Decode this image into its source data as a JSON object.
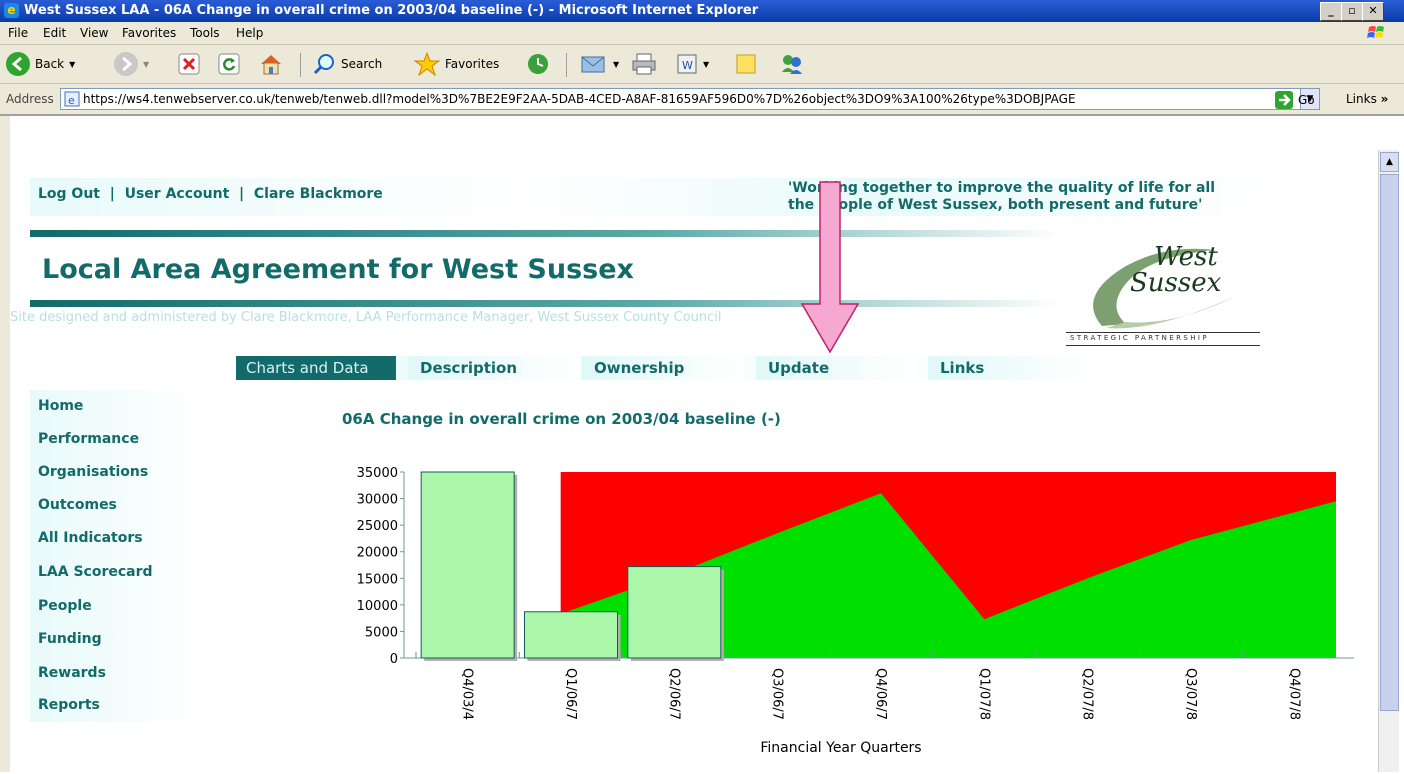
{
  "window": {
    "title": "West Sussex LAA - 06A Change in overall crime on 2003/04 baseline (-) - Microsoft Internet Explorer"
  },
  "menu": [
    "File",
    "Edit",
    "View",
    "Favorites",
    "Tools",
    "Help"
  ],
  "toolbar": {
    "back": "Back",
    "search": "Search",
    "favorites": "Favorites"
  },
  "address": {
    "label": "Address",
    "url": "https://ws4.tenwebserver.co.uk/tenweb/tenweb.dll?model%3D%7BE2E9F2AA-5DAB-4CED-A8AF-81659AF596D0%7D%26object%3DO9%3A100%26type%3DOBJPAGE",
    "go": "Go",
    "links": "Links"
  },
  "site": {
    "user_links": [
      "Log Out",
      "User Account",
      "Clare Blackmore"
    ],
    "slogan_line1": "'Working together to improve the quality of life for all",
    "slogan_line2": "the people of West Sussex, both present and future'",
    "heading": "Local Area Agreement for West Sussex",
    "credit": "Site designed and administered by Clare Blackmore, LAA Performance Manager, West Sussex County Council",
    "logo_word1": "West",
    "logo_word2": "Sussex",
    "logo_tagline": "STRATEGIC PARTNERSHIP"
  },
  "tabs": [
    "Charts and Data",
    "Description",
    "Ownership",
    "Update",
    "Links"
  ],
  "sidebar": [
    "Home",
    "Performance",
    "Organisations",
    "Outcomes",
    "All Indicators",
    "LAA Scorecard",
    "People",
    "Funding",
    "Rewards",
    "Reports"
  ],
  "chart_title": "06A Change in overall crime on 2003/04 baseline (-)",
  "colors": {
    "teal": "#136a6a",
    "bar_fill": "#aaf7a9",
    "target_green": "#00e000",
    "red": "#ff0000",
    "arrow_pink": "#f5a8d0"
  },
  "chart_data": {
    "type": "bar",
    "categories": [
      "Q4/03/4",
      "Q1/06/7",
      "Q2/06/7",
      "Q3/06/7",
      "Q4/06/7",
      "Q1/07/8",
      "Q2/07/8",
      "Q3/07/8",
      "Q4/07/8"
    ],
    "values": [
      35000,
      8700,
      17200,
      null,
      null,
      null,
      null,
      null,
      null
    ],
    "area_threshold": [
      null,
      8300,
      15800,
      23500,
      31000,
      7300,
      15000,
      22200,
      29500
    ],
    "xlabel": "Financial Year Quarters",
    "ylabel": "",
    "ylim": [
      0,
      35000
    ],
    "yticks": [
      0,
      5000,
      10000,
      15000,
      20000,
      25000,
      30000,
      35000
    ],
    "area_colors": {
      "below": "#00e000",
      "above": "#ff0000"
    }
  }
}
